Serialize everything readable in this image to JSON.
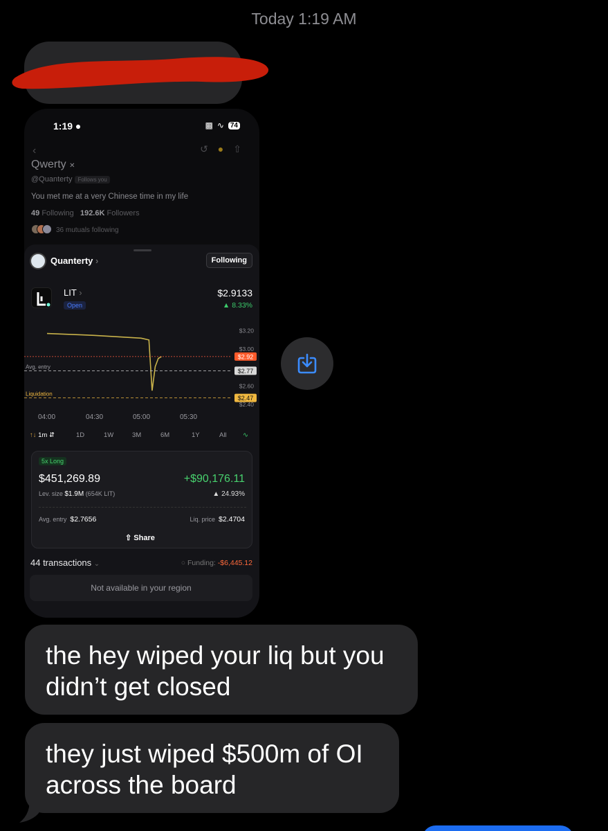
{
  "header": {
    "timestamp": "Today 1:19 AM"
  },
  "screenshot": {
    "status": {
      "time": "1:19",
      "battery": "74"
    },
    "profile": {
      "name": "Qwerty",
      "handle": "@Quanterty",
      "follows_badge": "Follows you",
      "bio": "You met me at a very Chinese time in my life",
      "following_count": "49",
      "following_label": "Following",
      "followers_count": "192.6K",
      "followers_label": "Followers",
      "mutuals": "36 mutuals following"
    },
    "trader": {
      "name": "Quanterty",
      "follow_button": "Following"
    },
    "ticker": {
      "symbol": "LIT",
      "status": "Open",
      "price": "$2.9133",
      "change": "8.33%"
    },
    "chart_data": {
      "type": "line",
      "x_ticks": [
        "04:00",
        "04:30",
        "05:00",
        "05:30"
      ],
      "y_ticks": [
        "$3.20",
        "$3.00",
        "$2.60",
        "$2.40"
      ],
      "price_tags": [
        "$2.92",
        "$2.77",
        "$2.47"
      ],
      "annotations": [
        "Avg. entry",
        "Liquidation"
      ],
      "ylim": [
        2.4,
        3.25
      ],
      "series": [
        {
          "x": [
            "04:00",
            "04:30",
            "05:00",
            "05:05",
            "05:07",
            "05:09",
            "05:11",
            "05:13"
          ],
          "y": [
            3.17,
            3.15,
            3.12,
            3.1,
            2.55,
            2.81,
            2.9,
            2.92
          ]
        }
      ],
      "avg_entry": 2.7656,
      "liquidation": 2.4704,
      "last_price": 2.92
    },
    "timeframes": {
      "interval": "1m",
      "ranges": [
        "1D",
        "1W",
        "3M",
        "6M",
        "1Y",
        "All"
      ]
    },
    "position": {
      "side": "5x Long",
      "value": "$451,269.89",
      "pnl": "+$90,176.11",
      "pnl_pct": "24.93%",
      "lev_label": "Lev. size",
      "lev_size": "$1.9M",
      "lev_units": "(654K LIT)",
      "entry_label": "Avg. entry",
      "entry": "$2.7656",
      "liq_label": "Liq. price",
      "liq": "$2.4704",
      "share": "Share"
    },
    "transactions": "44 transactions",
    "funding_label": "Funding:",
    "funding_value": "-$6,445.12",
    "region_notice": "Not available in your region"
  },
  "messages": [
    {
      "text": "the hey wiped your liq but you didn’t get closed"
    },
    {
      "text": "they just wiped $500m of OI across the board"
    }
  ],
  "colors": {
    "bubble": "#262628",
    "green": "#3ccb6b",
    "orange": "#ff6a3c",
    "accent_blue": "#1c6cf0"
  }
}
